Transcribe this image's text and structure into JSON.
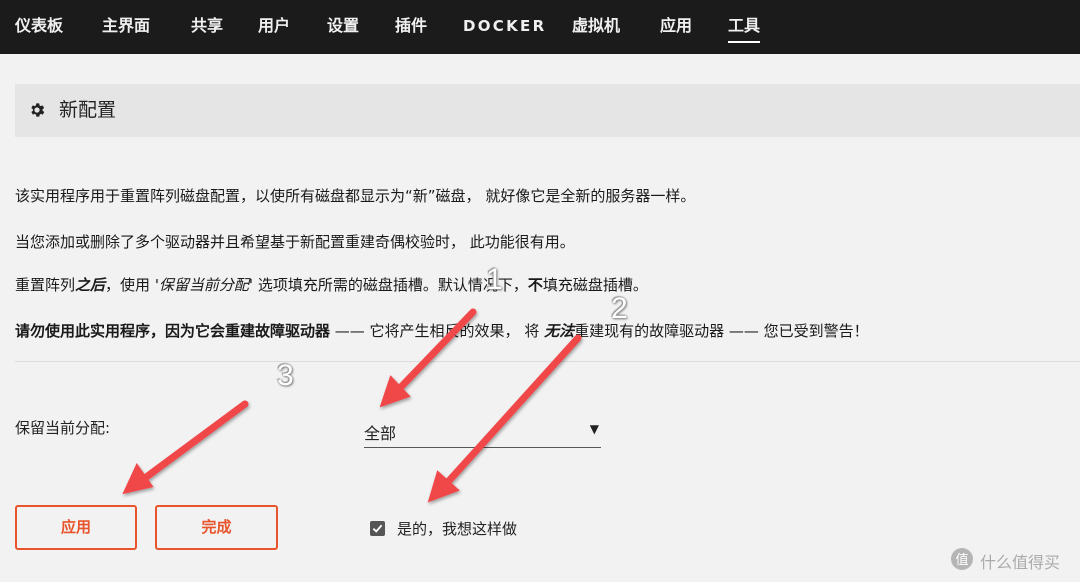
{
  "nav": {
    "items": [
      "仪表板",
      "主界面",
      "共享",
      "用户",
      "设置",
      "插件",
      "DOCKER",
      "虚拟机",
      "应用",
      "工具"
    ],
    "active": "工具"
  },
  "page": {
    "title": "新配置",
    "title_icon": "gear-icon"
  },
  "description": {
    "line1": "该实用程序用于重置阵列磁盘配置，以使所有磁盘都显示为“新”磁盘， 就好像它是全新的服务器一样。",
    "line2": "当您添加或删除了多个驱动器并且希望基于新配置重建奇偶校验时， 此功能很有用。",
    "line3": {
      "a": "重置阵列",
      "b": "之后",
      "c": "，使用 ",
      "d": "'保留当前分配'",
      "e": " 选项填充所需的磁盘插槽。默认情况下，",
      "f": "不",
      "g": "填充磁盘插槽。"
    },
    "line4": {
      "a": "请勿使用此实用程序，因为它会重建故障驱动器",
      "b": " —— 它将产生相反的效果， 将 ",
      "c": "无法",
      "d": "重建现有的故障驱动器 —— 您已受到警告！"
    }
  },
  "form": {
    "keep_label": "保留当前分配:",
    "keep_value": "全部",
    "confirm_label": "是的，我想这样做",
    "confirm_checked": true,
    "apply_label": "应用",
    "done_label": "完成"
  },
  "annotations": {
    "numbers": [
      "1",
      "2",
      "3"
    ],
    "arrow_color": "#f0464a"
  },
  "watermark": {
    "text": "什么值得买",
    "icon": "zdm-logo-icon"
  },
  "colors": {
    "nav_bg": "#1c1b1b",
    "accent": "#e8542b",
    "page_bg": "#f2f2f2"
  }
}
